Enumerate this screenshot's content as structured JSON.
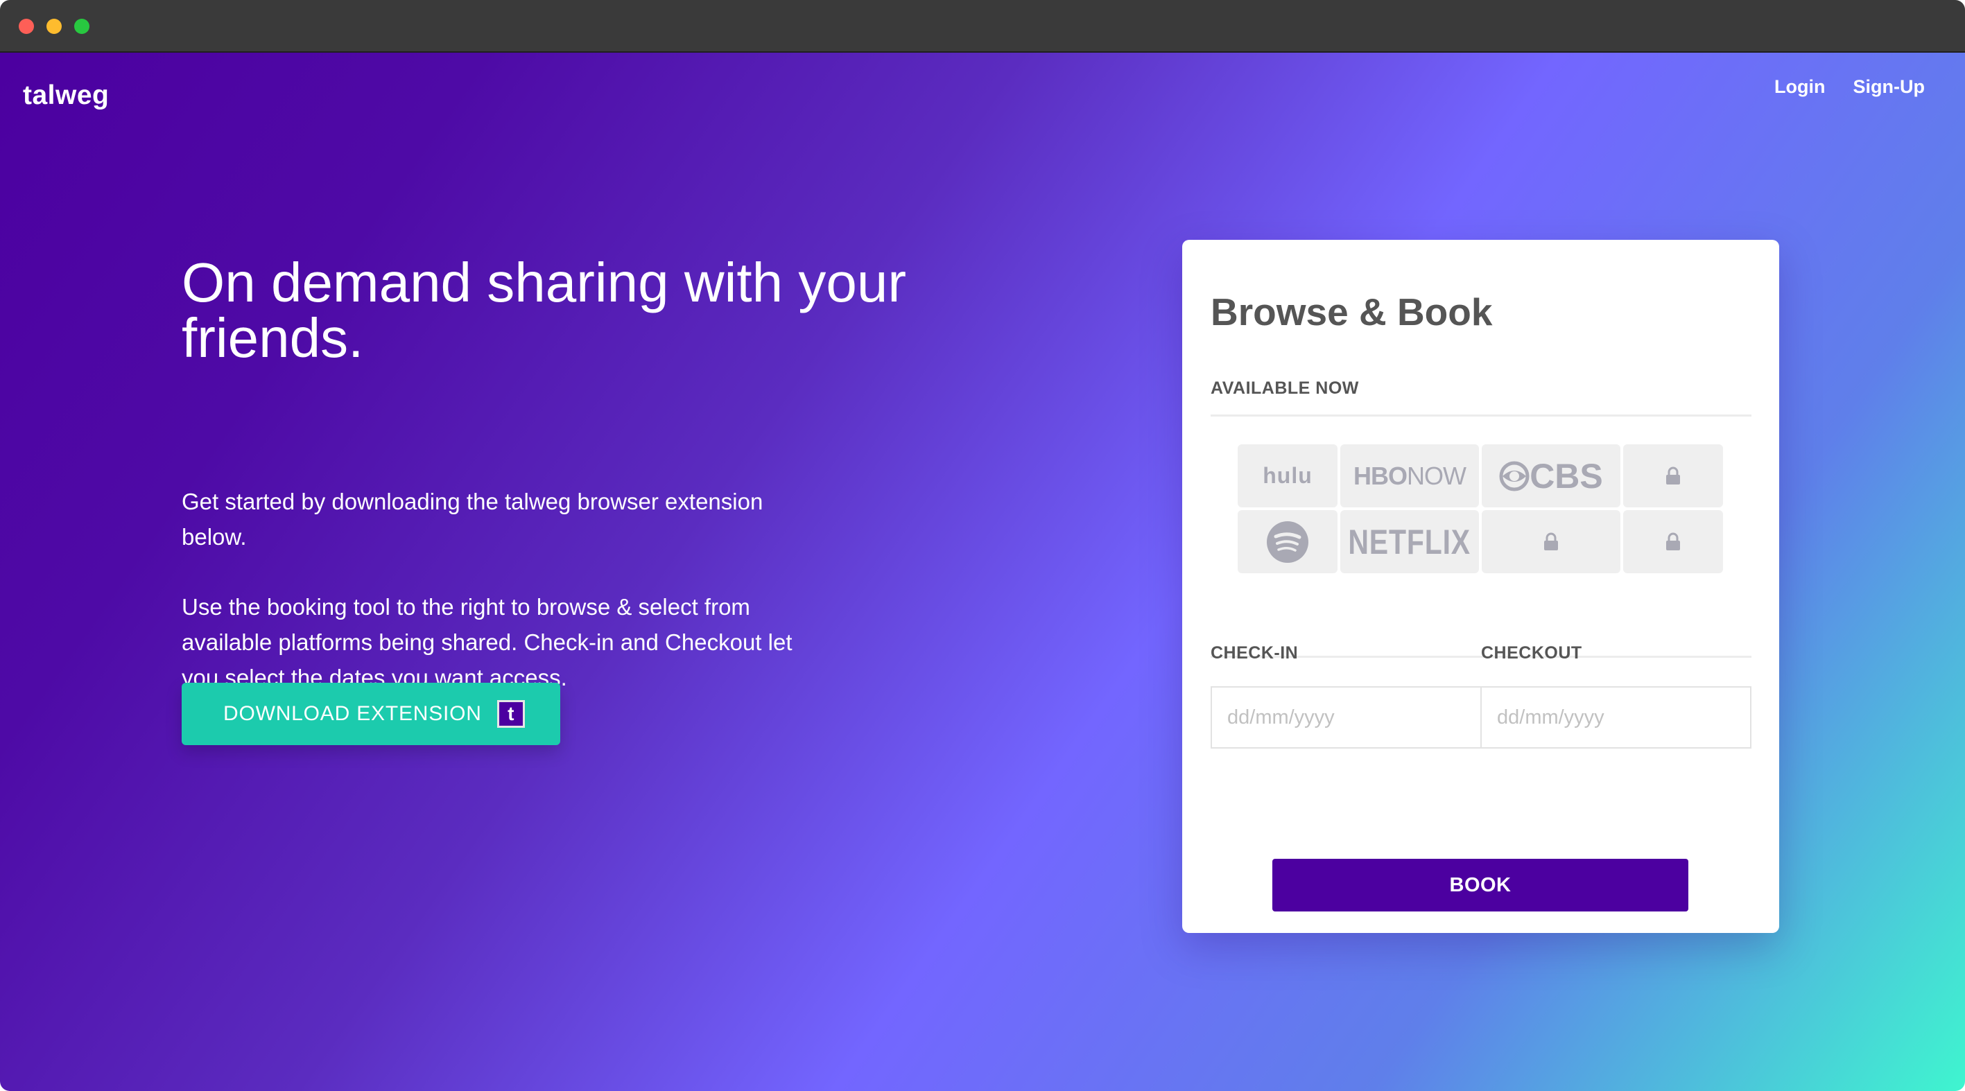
{
  "brand": "talweg",
  "nav": {
    "login": "Login",
    "signup": "Sign-Up"
  },
  "hero": {
    "headline": "On demand sharing with your friends.",
    "paragraph1": "Get started by downloading the talweg browser extension below.",
    "paragraph2": "Use the booking tool to the right to browse & select from available platforms being shared. Check-in and Checkout let you select the dates you want access.",
    "download_label": "DOWNLOAD EXTENSION",
    "download_icon_text": "t"
  },
  "booking": {
    "title": "Browse & Book",
    "available_label": "AVAILABLE NOW",
    "platforms": {
      "hulu": "hulu",
      "hbo_bold": "HBO",
      "hbo_light": "NOW",
      "cbs": "CBS",
      "netflix": "NETFLIX"
    },
    "checkin_label": "CHECK-IN",
    "checkout_label": "CHECKOUT",
    "checkin_placeholder": "dd/mm/yyyy",
    "checkout_placeholder": "dd/mm/yyyy",
    "book_label": "BOOK"
  },
  "colors": {
    "brand_purple": "#4c00a0",
    "teal": "#1ccbad",
    "tile_gray": "#efefef",
    "logo_gray": "#a9a9b4"
  },
  "icons": [
    "lock-icon",
    "spotify-icon",
    "cbs-eye-icon",
    "t-logo-icon"
  ]
}
